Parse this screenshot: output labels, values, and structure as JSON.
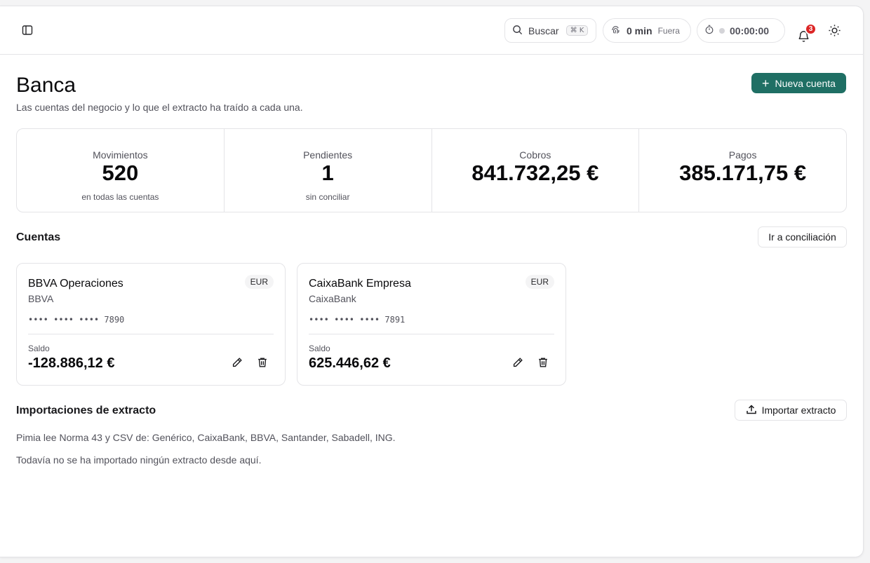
{
  "topbar": {
    "search_label": "Buscar",
    "search_shortcut": "⌘ K",
    "presence_value": "0 min",
    "presence_status": "Fuera",
    "timer_value": "00:00:00",
    "notifications_count": "3"
  },
  "header": {
    "title": "Banca",
    "subtitle": "Las cuentas del negocio y lo que el extracto ha traído a cada una.",
    "new_account_label": "Nueva cuenta"
  },
  "stats": [
    {
      "label": "Movimientos",
      "value": "520",
      "note": "en todas las cuentas"
    },
    {
      "label": "Pendientes",
      "value": "1",
      "note": "sin conciliar"
    },
    {
      "label": "Cobros",
      "value": "841.732,25 €",
      "note": ""
    },
    {
      "label": "Pagos",
      "value": "385.171,75 €",
      "note": ""
    }
  ],
  "accounts_section": {
    "title": "Cuentas",
    "reconcile_label": "Ir a conciliación",
    "balance_label": "Saldo",
    "items": [
      {
        "name": "BBVA Operaciones",
        "bank": "BBVA",
        "currency": "EUR",
        "number": "•••• •••• •••• 7890",
        "balance": "-128.886,12 €"
      },
      {
        "name": "CaixaBank Empresa",
        "bank": "CaixaBank",
        "currency": "EUR",
        "number": "•••• •••• •••• 7891",
        "balance": "625.446,62 €"
      }
    ]
  },
  "imports_section": {
    "title": "Importaciones de extracto",
    "import_label": "Importar extracto",
    "formats_text": "Pimia lee Norma 43 y CSV de: Genérico, CaixaBank, BBVA, Santander, Sabadell, ING.",
    "empty_text": "Todavía no se ha importado ningún extracto desde aquí."
  },
  "colors": {
    "primary": "#1f6f64",
    "badge": "#dc2626",
    "border": "#e4e4e7"
  },
  "icons": [
    "sidebar-toggle-icon",
    "search-icon",
    "fingerprint-icon",
    "stopwatch-icon",
    "bell-icon",
    "sun-icon",
    "plus-icon",
    "pencil-icon",
    "trash-icon",
    "upload-icon"
  ]
}
